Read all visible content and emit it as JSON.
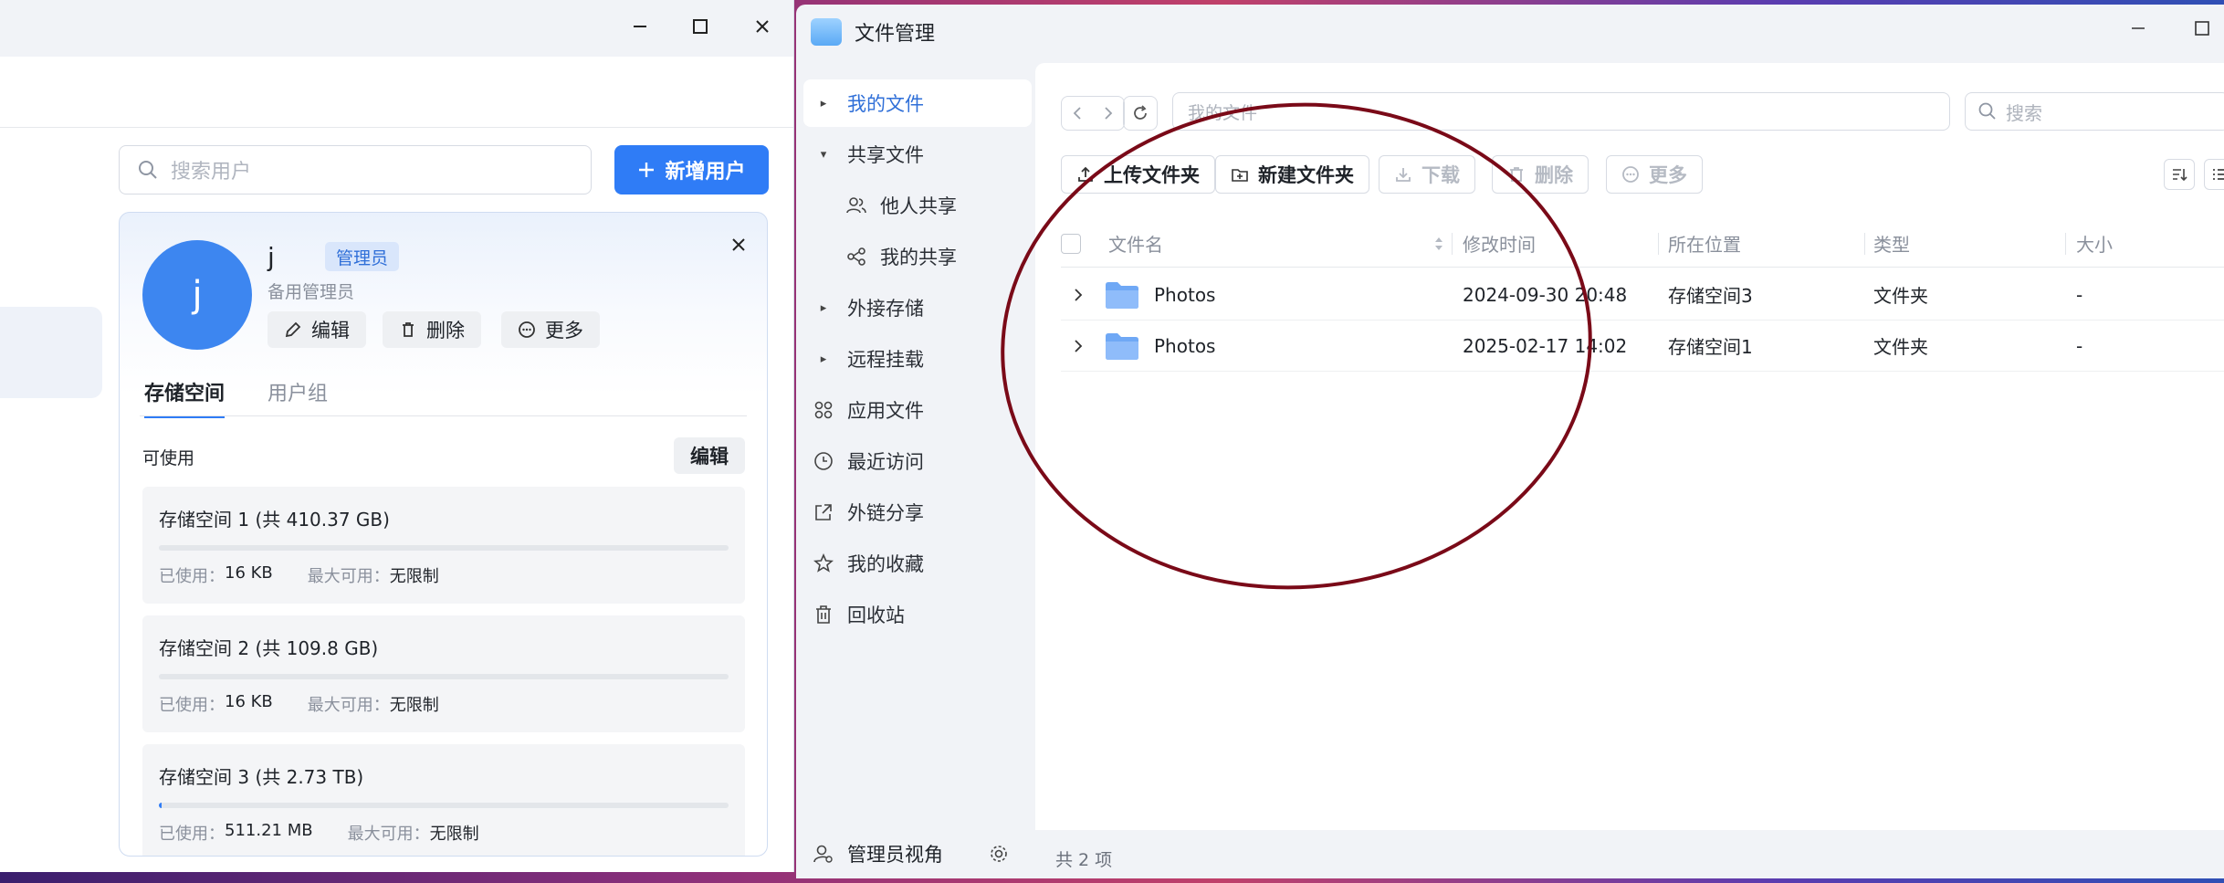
{
  "left_window": {
    "search_placeholder": "搜索用户",
    "add_user_label": "新增用户",
    "user": {
      "avatar_letter": "j",
      "name": "j",
      "badge": "管理员",
      "role": "备用管理员"
    },
    "actions": {
      "edit": "编辑",
      "delete": "删除",
      "more": "更多"
    },
    "tabs": {
      "storage": "存储空间",
      "groups": "用户组"
    },
    "available_label": "可使用",
    "available_edit": "编辑",
    "storages": [
      {
        "title": "存储空间 1 (共 410.37 GB)",
        "used_label": "已使用：",
        "used": "16 KB",
        "max_label": "最大可用：",
        "max": "无限制",
        "fill": 0
      },
      {
        "title": "存储空间 2 (共 109.8 GB)",
        "used_label": "已使用：",
        "used": "16 KB",
        "max_label": "最大可用：",
        "max": "无限制",
        "fill": 0
      },
      {
        "title": "存储空间 3 (共 2.73 TB)",
        "used_label": "已使用：",
        "used": "511.21 MB",
        "max_label": "最大可用：",
        "max": "无限制",
        "fill": 0.005
      }
    ]
  },
  "right_window": {
    "title": "文件管理",
    "sidebar": {
      "items": [
        {
          "label": "我的文件",
          "icon": "caret-right-icon"
        },
        {
          "label": "共享文件",
          "icon": "caret-down-icon"
        },
        {
          "label": "他人共享",
          "icon": "users-icon"
        },
        {
          "label": "我的共享",
          "icon": "share-icon"
        },
        {
          "label": "外接存储",
          "icon": "caret-right-icon"
        },
        {
          "label": "远程挂载",
          "icon": "caret-right-icon"
        },
        {
          "label": "应用文件",
          "icon": "apps-icon"
        },
        {
          "label": "最近访问",
          "icon": "clock-icon"
        },
        {
          "label": "外链分享",
          "icon": "link-share-icon"
        },
        {
          "label": "我的收藏",
          "icon": "star-icon"
        },
        {
          "label": "回收站",
          "icon": "trash-icon"
        }
      ],
      "footer_label": "管理员视角"
    },
    "path_text": "我的文件",
    "search_placeholder": "搜索",
    "toolbar": {
      "upload": "上传文件夹",
      "new_folder": "新建文件夹",
      "download": "下载",
      "delete": "删除",
      "more": "更多"
    },
    "columns": {
      "name": "文件名",
      "modified": "修改时间",
      "location": "所在位置",
      "type": "类型",
      "size": "大小"
    },
    "rows": [
      {
        "name": "Photos",
        "modified": "2024-09-30 20:48",
        "location": "存储空间3",
        "type": "文件夹",
        "size": "-"
      },
      {
        "name": "Photos",
        "modified": "2025-02-17 14:02",
        "location": "存储空间1",
        "type": "文件夹",
        "size": "-"
      }
    ],
    "footer_count": "共 2 项"
  },
  "colors": {
    "accent": "#2f7cf6",
    "annotation": "#7a0a18",
    "scroll_thumb": "#f7c200"
  }
}
